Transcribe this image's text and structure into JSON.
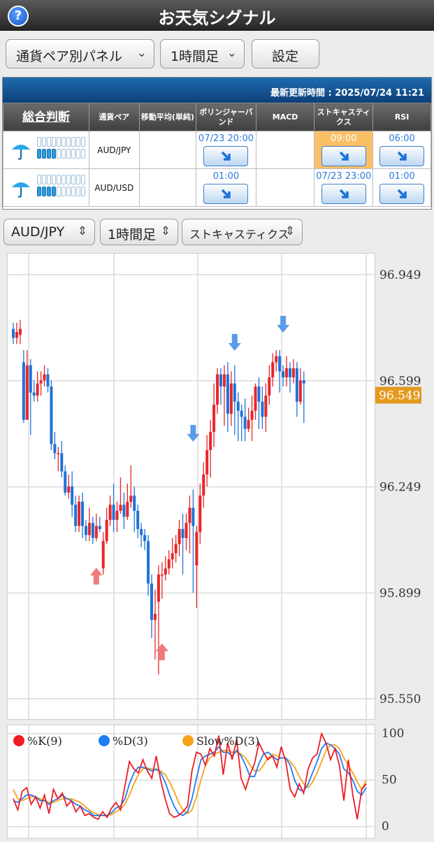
{
  "header": {
    "title": "お天気シグナル",
    "help_icon_label": "?"
  },
  "toolbar": {
    "view_select": "通貨ペア別パネル",
    "timeframe_select": "1時間足",
    "settings_button": "設定"
  },
  "panel": {
    "last_update": "最新更新時間 : 2025/07/24 11:21",
    "columns": [
      "総合判断",
      "通貨ペア",
      "移動平均(単純)",
      "ボリンジャーバンド",
      "MACD",
      "ストキャスティクス",
      "RSI"
    ],
    "rows": [
      {
        "pair": "AUD/JPY",
        "forecast_icon": "umbrella-icon",
        "gauge_filled": 4,
        "gauge_total": 10,
        "ma": "",
        "bollinger": "07/23 20:00",
        "macd": "",
        "stoch": "09:00",
        "rsi": "06:00"
      },
      {
        "pair": "AUD/USD",
        "forecast_icon": "umbrella-icon",
        "gauge_filled": 4,
        "gauge_total": 10,
        "ma": "",
        "bollinger": "01:00",
        "macd": "",
        "stoch": "07/23 23:00",
        "rsi": "01:00"
      }
    ],
    "signal_direction": "down-right",
    "highlight_color": "#fbbf66"
  },
  "chart_controls": {
    "pair_select": "AUD/JPY",
    "timeframe_select": "1時間足",
    "indicator_select": "ストキャスティクス"
  },
  "chart_data": [
    {
      "type": "candlestick",
      "y_ticks": [
        "96.949",
        "96.599",
        "96.249",
        "95.899",
        "95.550"
      ],
      "ylim": [
        95.55,
        96.949
      ],
      "current_price": "96.549",
      "up_color": "#e8262a",
      "down_color": "#1e73d8",
      "price_tag_color": "#e39a1f",
      "candles": [
        [
          96.77,
          96.74,
          96.79,
          96.72
        ],
        [
          96.74,
          96.76,
          96.79,
          96.72
        ],
        [
          96.75,
          96.77,
          96.8,
          96.72
        ],
        [
          96.66,
          96.47,
          96.7,
          96.46
        ],
        [
          96.47,
          96.65,
          96.7,
          96.47
        ],
        [
          96.65,
          96.56,
          96.67,
          96.42
        ],
        [
          96.56,
          96.55,
          96.6,
          96.53
        ],
        [
          96.55,
          96.59,
          96.63,
          96.53
        ],
        [
          96.59,
          96.6,
          96.63,
          96.55
        ],
        [
          96.6,
          96.62,
          96.65,
          96.58
        ],
        [
          96.62,
          96.58,
          96.64,
          96.56
        ],
        [
          96.58,
          96.39,
          96.6,
          96.37
        ],
        [
          96.39,
          96.36,
          96.43,
          96.34
        ],
        [
          96.36,
          96.36,
          96.38,
          96.3
        ],
        [
          96.36,
          96.3,
          96.4,
          96.28
        ],
        [
          96.3,
          96.23,
          96.32,
          96.22
        ],
        [
          96.23,
          96.25,
          96.29,
          96.21
        ],
        [
          96.25,
          96.19,
          96.3,
          96.15
        ],
        [
          96.19,
          96.12,
          96.22,
          96.1
        ],
        [
          96.12,
          96.2,
          96.22,
          96.1
        ],
        [
          96.2,
          96.12,
          96.23,
          96.08
        ],
        [
          96.12,
          96.09,
          96.14,
          96.07
        ],
        [
          96.09,
          96.13,
          96.18,
          96.07
        ],
        [
          96.13,
          96.08,
          96.15,
          96.06
        ],
        [
          96.08,
          96.12,
          96.16,
          96.07
        ],
        [
          96.12,
          96.11,
          96.15,
          96.1
        ],
        [
          95.98,
          96.07,
          96.1,
          95.96
        ],
        [
          96.07,
          96.14,
          96.18,
          96.06
        ],
        [
          96.14,
          96.19,
          96.22,
          96.12
        ],
        [
          96.19,
          96.14,
          96.26,
          96.1
        ],
        [
          96.14,
          96.17,
          96.2,
          96.1
        ],
        [
          96.17,
          96.19,
          96.28,
          96.16
        ],
        [
          96.19,
          96.15,
          96.23,
          96.11
        ],
        [
          96.15,
          96.2,
          96.26,
          96.14
        ],
        [
          96.2,
          96.22,
          96.32,
          96.18
        ],
        [
          96.22,
          96.17,
          96.25,
          96.1
        ],
        [
          96.17,
          96.11,
          96.19,
          96.08
        ],
        [
          96.11,
          96.09,
          96.13,
          96.05
        ],
        [
          96.09,
          96.07,
          96.11,
          96.04
        ],
        [
          96.07,
          95.93,
          96.09,
          95.89
        ],
        [
          95.93,
          95.81,
          95.96,
          95.75
        ],
        [
          95.81,
          95.83,
          95.91,
          95.68
        ],
        [
          95.87,
          95.96,
          95.99,
          95.63
        ],
        [
          95.96,
          95.96,
          96.0,
          95.88
        ],
        [
          95.96,
          95.98,
          96.02,
          95.94
        ],
        [
          95.98,
          96.01,
          96.04,
          95.96
        ],
        [
          96.01,
          96.03,
          96.08,
          95.98
        ],
        [
          96.03,
          96.06,
          96.09,
          96.0
        ],
        [
          96.06,
          96.11,
          96.14,
          96.02
        ],
        [
          96.11,
          96.08,
          96.16,
          95.96
        ],
        [
          96.08,
          96.13,
          96.16,
          96.04
        ],
        [
          96.13,
          96.18,
          96.22,
          96.03
        ],
        [
          96.18,
          96.12,
          96.24,
          95.9
        ],
        [
          95.99,
          96.1,
          96.12,
          95.85
        ],
        [
          96.1,
          96.22,
          96.26,
          96.06
        ],
        [
          96.22,
          96.29,
          96.33,
          96.18
        ],
        [
          96.29,
          96.37,
          96.42,
          96.25
        ],
        [
          96.37,
          96.43,
          96.47,
          96.28
        ],
        [
          96.43,
          96.52,
          96.59,
          96.38
        ],
        [
          96.52,
          96.62,
          96.64,
          96.49
        ],
        [
          96.62,
          96.58,
          96.64,
          96.52
        ],
        [
          96.58,
          96.62,
          96.65,
          96.45
        ],
        [
          96.62,
          96.49,
          96.66,
          96.43
        ],
        [
          96.49,
          96.59,
          96.63,
          96.45
        ],
        [
          96.59,
          96.53,
          96.65,
          96.42
        ],
        [
          96.53,
          96.5,
          96.56,
          96.4
        ],
        [
          96.5,
          96.48,
          96.52,
          96.4
        ],
        [
          96.48,
          96.44,
          96.54,
          96.4
        ],
        [
          96.44,
          96.47,
          96.51,
          96.43
        ],
        [
          96.47,
          96.5,
          96.55,
          96.4
        ],
        [
          96.5,
          96.58,
          96.59,
          96.47
        ],
        [
          96.58,
          96.53,
          96.61,
          96.44
        ],
        [
          96.53,
          96.48,
          96.58,
          96.44
        ],
        [
          96.48,
          96.55,
          96.59,
          96.43
        ],
        [
          96.55,
          96.61,
          96.65,
          96.52
        ],
        [
          96.61,
          96.66,
          96.69,
          96.58
        ],
        [
          96.66,
          96.68,
          96.7,
          96.63
        ],
        [
          96.68,
          96.63,
          96.7,
          96.56
        ],
        [
          96.63,
          96.61,
          96.65,
          96.58
        ],
        [
          96.61,
          96.64,
          96.68,
          96.58
        ],
        [
          96.64,
          96.61,
          96.66,
          96.56
        ],
        [
          96.61,
          96.64,
          96.67,
          96.59
        ],
        [
          96.64,
          96.53,
          96.66,
          96.48
        ],
        [
          96.53,
          96.6,
          96.64,
          96.52
        ],
        [
          96.6,
          96.59,
          96.63,
          96.46
        ]
      ],
      "signals": [
        {
          "type": "buy",
          "index": 24,
          "price": 95.95
        },
        {
          "type": "buy",
          "index": 43,
          "price": 95.7
        },
        {
          "type": "sell",
          "index": 52,
          "price": 96.43
        },
        {
          "type": "sell",
          "index": 64,
          "price": 96.73
        },
        {
          "type": "sell",
          "index": 78,
          "price": 96.79
        }
      ],
      "signal_colors": {
        "buy": "#f07a7a",
        "sell": "#5b9bea"
      }
    },
    {
      "type": "line",
      "legend": [
        "%K(9)",
        "%D(3)",
        "Slow%D(3)"
      ],
      "y_ticks": [
        "100",
        "50",
        "0"
      ],
      "ylim": [
        0,
        100
      ],
      "series": [
        {
          "name": "%K(9)",
          "color": "#ee1c25",
          "values": [
            30,
            18,
            38,
            42,
            24,
            32,
            20,
            34,
            14,
            40,
            30,
            36,
            22,
            28,
            16,
            22,
            12,
            14,
            10,
            8,
            16,
            10,
            20,
            26,
            18,
            44,
            70,
            62,
            58,
            72,
            60,
            52,
            76,
            50,
            30,
            14,
            10,
            12,
            16,
            22,
            60,
            80,
            78,
            66,
            84,
            76,
            98,
            56,
            90,
            72,
            94,
            52,
            40,
            56,
            68,
            90,
            80,
            72,
            76,
            64,
            86,
            70,
            40,
            32,
            46,
            36,
            62,
            74,
            78,
            100,
            90,
            72,
            84,
            66,
            28,
            72,
            34,
            8,
            40,
            46
          ]
        },
        {
          "name": "%D(3)",
          "color": "#1f7cf2",
          "values": [
            28,
            26,
            30,
            34,
            34,
            32,
            28,
            28,
            24,
            28,
            30,
            34,
            30,
            28,
            24,
            22,
            18,
            16,
            12,
            12,
            12,
            12,
            15,
            20,
            22,
            30,
            46,
            58,
            64,
            64,
            62,
            60,
            62,
            58,
            48,
            34,
            22,
            14,
            12,
            16,
            30,
            52,
            72,
            76,
            78,
            80,
            86,
            80,
            80,
            76,
            82,
            76,
            66,
            54,
            54,
            68,
            78,
            80,
            76,
            72,
            74,
            74,
            66,
            50,
            40,
            38,
            46,
            58,
            70,
            84,
            90,
            88,
            84,
            78,
            62,
            58,
            50,
            38,
            34,
            42
          ]
        },
        {
          "name": "Slow%D(3)",
          "color": "#f7a21b",
          "values": [
            40,
            30,
            28,
            30,
            32,
            32,
            30,
            28,
            26,
            26,
            28,
            30,
            30,
            30,
            28,
            26,
            22,
            18,
            15,
            13,
            12,
            12,
            13,
            16,
            19,
            24,
            34,
            46,
            56,
            62,
            63,
            62,
            61,
            60,
            56,
            48,
            38,
            26,
            18,
            14,
            18,
            32,
            50,
            66,
            74,
            78,
            80,
            82,
            82,
            80,
            80,
            78,
            74,
            66,
            60,
            60,
            66,
            74,
            78,
            76,
            74,
            74,
            70,
            64,
            54,
            46,
            42,
            48,
            58,
            70,
            82,
            88,
            88,
            84,
            74,
            66,
            58,
            48,
            40,
            50
          ]
        }
      ]
    }
  ]
}
